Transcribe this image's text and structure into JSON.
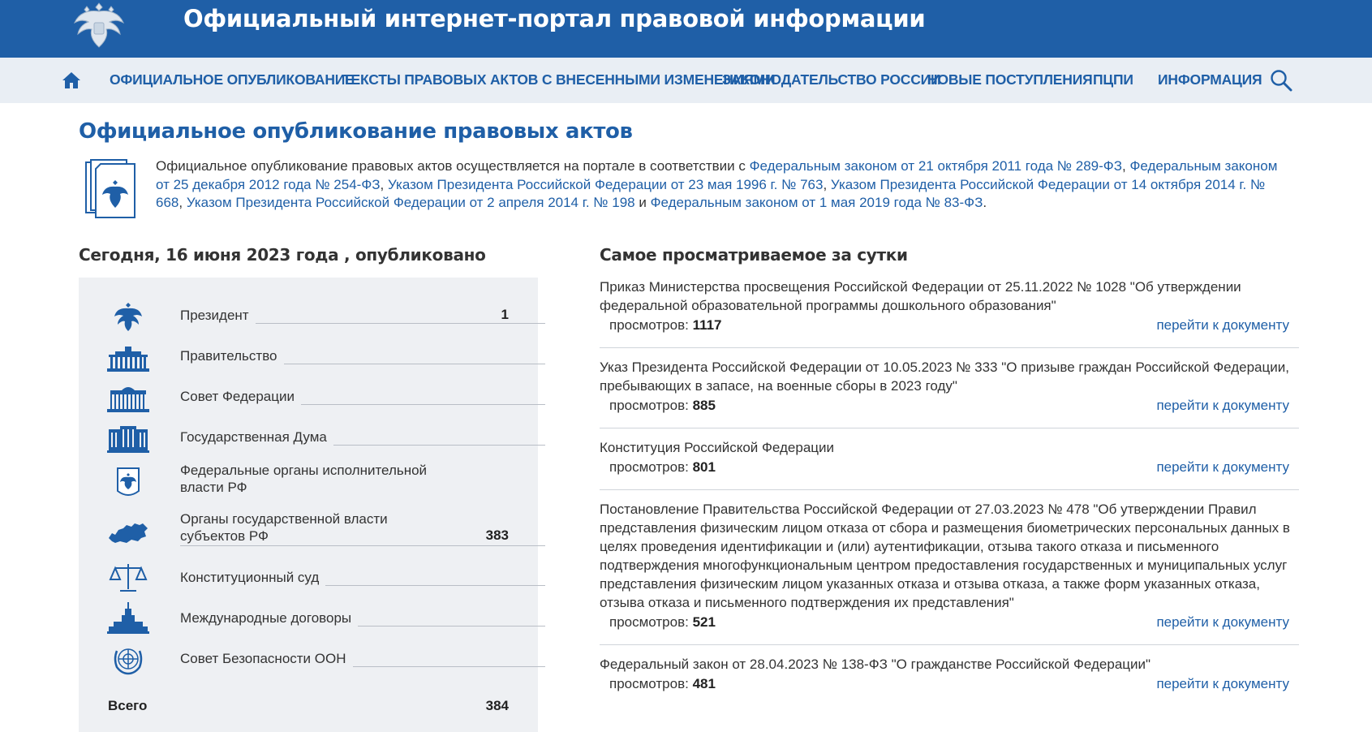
{
  "header": {
    "title": "Официальный интернет-портал правовой информации"
  },
  "nav": {
    "items": [
      "Официальное опубликование",
      "Тексты правовых актов с внесенными изменениями",
      "Законодательство России",
      "Новые поступления",
      "ПЦПИ",
      "Информация"
    ]
  },
  "page": {
    "title": "Официальное опубликование правовых актов",
    "intro_text": "Официальное опубликование правовых актов осуществляется на портале в соответствии с ",
    "intro_links": [
      "Федеральным  законом от 21 октября 2011 года № 289-ФЗ",
      "Федеральным законом от 25 декабря 2012 года № 254-ФЗ",
      "Указом Президента Российской Федерации от 23 мая 1996 г. № 763",
      "Указом Президента Российской Федерации от 14 октября 2014 г. № 668",
      "Указом Президента Российской Федерации от 2 апреля 2014 г. № 198",
      "Федеральным законом от 1 мая 2019 года № 83-ФЗ"
    ],
    "sep_comma": ", ",
    "sep_and": " и ",
    "end_dot": "."
  },
  "today": {
    "title": "Сегодня, 16 июня 2023 года , опубликовано",
    "authorities": [
      {
        "label": "Президент",
        "count": "1",
        "icon": "emblem-icon"
      },
      {
        "label": "Правительство",
        "count": "",
        "icon": "government-building-icon"
      },
      {
        "label": "Совет Федерации",
        "count": "",
        "icon": "federation-council-building-icon"
      },
      {
        "label": "Государственная Дума",
        "count": "",
        "icon": "state-duma-building-icon"
      },
      {
        "label": "Федеральные органы исполнительной власти РФ",
        "count": "",
        "icon": "shield-emblem-icon"
      },
      {
        "label": "Органы государственной власти субъектов РФ",
        "count": "383",
        "icon": "russia-map-icon"
      },
      {
        "label": "Конституционный суд",
        "count": "",
        "icon": "scales-icon"
      },
      {
        "label": "Международные договоры",
        "count": "",
        "icon": "tower-building-icon"
      },
      {
        "label": "Совет Безопасности ООН",
        "count": "",
        "icon": "un-emblem-icon"
      }
    ],
    "total_label": "Всего",
    "total_count": "384"
  },
  "popular": {
    "title": "Самое просматриваемое за сутки",
    "views_label": "просмотров: ",
    "link_label": "перейти к документу",
    "items": [
      {
        "title": "Приказ Министерства просвещения Российской Федерации от 25.11.2022 № 1028 \"Об утверждении федеральной образовательной программы дошкольного образования\"",
        "views": "1117"
      },
      {
        "title": "Указ Президента Российской Федерации от 10.05.2023 № 333 \"О призыве граждан Российской Федерации, пребывающих в запасе, на военные сборы в 2023 году\"",
        "views": "885"
      },
      {
        "title": "Конституция Российской Федерации",
        "views": "801"
      },
      {
        "title": "Постановление Правительства Российской Федерации от 27.03.2023 № 478 \"Об утверждении Правил представления физическим лицом отказа от сбора и размещения биометрических персональных данных в целях проведения идентификации и (или) аутентификации, отзыва такого отказа и письменного подтверждения многофункциональным центром предоставления государственных и муниципальных услуг представления физическим лицом указанных отказа и отзыва отказа, а также форм указанных отказа, отзыва отказа и письменного подтверждения их представления\"",
        "views": "521"
      },
      {
        "title": "Федеральный закон от 28.04.2023 № 138-ФЗ \"О гражданстве Российской Федерации\"",
        "views": "481"
      }
    ]
  },
  "colors": {
    "brand": "#1f5fa7",
    "nav_bg": "#e9eef4",
    "panel_bg": "#eef0f3"
  }
}
